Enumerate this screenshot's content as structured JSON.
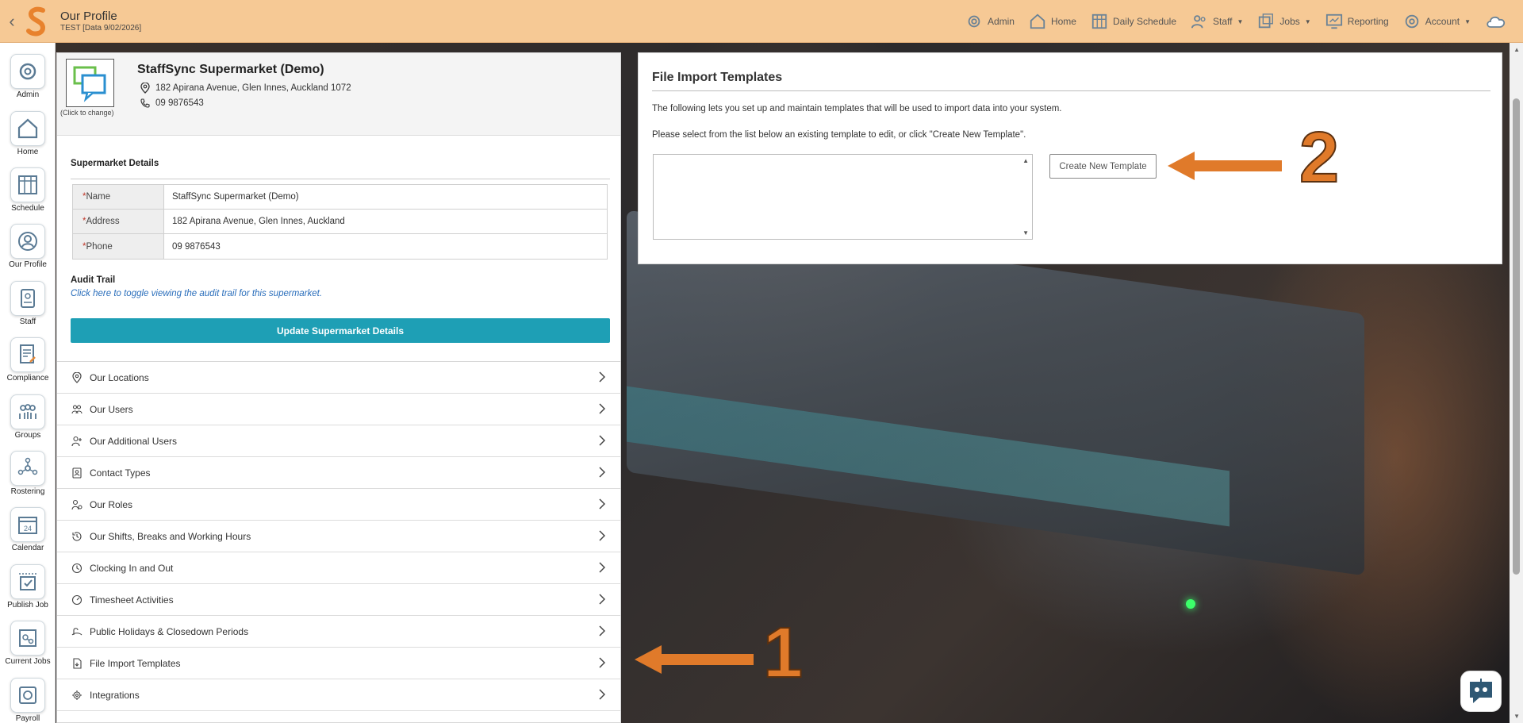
{
  "header": {
    "title": "Our Profile",
    "subtitle": "TEST [Data 9/02/2026]",
    "nav": [
      {
        "label": "Admin",
        "icon": "gear-icon"
      },
      {
        "label": "Home",
        "icon": "home-icon"
      },
      {
        "label": "Daily Schedule",
        "icon": "schedule-icon"
      },
      {
        "label": "Staff",
        "icon": "staff-icon",
        "dropdown": true
      },
      {
        "label": "Jobs",
        "icon": "jobs-icon",
        "dropdown": true
      },
      {
        "label": "Reporting",
        "icon": "reporting-icon"
      },
      {
        "label": "Account",
        "icon": "account-icon",
        "dropdown": true
      }
    ]
  },
  "sidebar": {
    "items": [
      {
        "label": "Admin",
        "icon": "gear-icon"
      },
      {
        "label": "Home",
        "icon": "home-icon"
      },
      {
        "label": "Schedule",
        "icon": "schedule-icon"
      },
      {
        "label": "Our Profile",
        "icon": "profile-icon"
      },
      {
        "label": "Staff",
        "icon": "staff-icon"
      },
      {
        "label": "Compliance",
        "icon": "compliance-icon"
      },
      {
        "label": "Groups",
        "icon": "groups-icon"
      },
      {
        "label": "Rostering",
        "icon": "rostering-icon"
      },
      {
        "label": "Calendar",
        "icon": "calendar-icon",
        "badge": "24"
      },
      {
        "label": "Publish Job",
        "icon": "publish-job-icon"
      },
      {
        "label": "Current Jobs",
        "icon": "current-jobs-icon"
      },
      {
        "label": "Payroll",
        "icon": "payroll-icon"
      }
    ]
  },
  "profile": {
    "logo_caption": "(Click to change)",
    "company_name": "StaffSync Supermarket (Demo)",
    "address_line": "182 Apirana Avenue, Glen Innes, Auckland 1072",
    "phone": "09 9876543",
    "details_title": "Supermarket Details",
    "fields": [
      {
        "label": "Name",
        "value": "StaffSync Supermarket (Demo)"
      },
      {
        "label": "Address",
        "value": "182 Apirana Avenue, Glen Innes, Auckland"
      },
      {
        "label": "Phone",
        "value": "09 9876543"
      }
    ],
    "audit_title": "Audit Trail",
    "audit_link": "Click here to toggle viewing the audit trail for this supermarket.",
    "update_button": "Update Supermarket Details"
  },
  "menu": {
    "items": [
      {
        "label": "Our Locations",
        "icon": "location-icon"
      },
      {
        "label": "Our Users",
        "icon": "users-icon"
      },
      {
        "label": "Our Additional Users",
        "icon": "add-user-icon"
      },
      {
        "label": "Contact Types",
        "icon": "contact-icon"
      },
      {
        "label": "Our Roles",
        "icon": "roles-icon"
      },
      {
        "label": "Our Shifts, Breaks and Working Hours",
        "icon": "history-icon"
      },
      {
        "label": "Clocking In and Out",
        "icon": "clock-icon"
      },
      {
        "label": "Timesheet Activities",
        "icon": "stopwatch-icon"
      },
      {
        "label": "Public Holidays & Closedown Periods",
        "icon": "holiday-icon"
      },
      {
        "label": "File Import Templates",
        "icon": "file-import-icon"
      },
      {
        "label": "Integrations",
        "icon": "integrations-icon"
      }
    ]
  },
  "file_import": {
    "title": "File Import Templates",
    "intro": "The following lets you set up and maintain templates that will be used to import data into your system.",
    "instructions": "Please select from the list below an existing template to edit, or click \"Create New Template\".",
    "create_button": "Create New Template"
  },
  "annotations": {
    "one": "1",
    "two": "2"
  },
  "colors": {
    "topbar": "#f6c995",
    "accent": "#1e9fb5",
    "annotation": "#e07a2a"
  }
}
